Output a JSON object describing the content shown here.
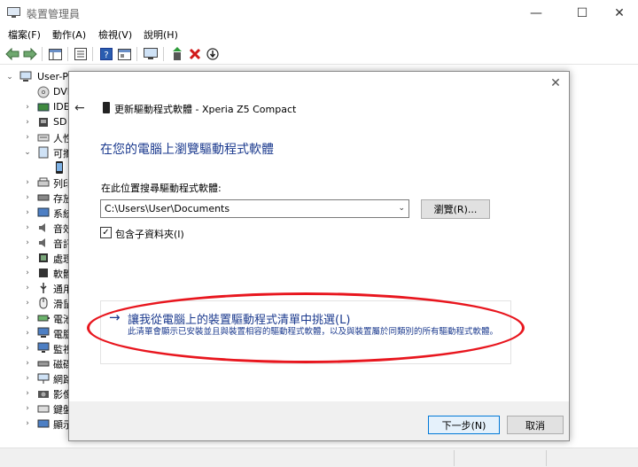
{
  "window": {
    "title": "裝置管理員",
    "min_glyph": "—",
    "max_glyph": "☐",
    "close_glyph": "✕"
  },
  "menu": {
    "items": [
      "檔案(F)",
      "動作(A)",
      "檢視(V)",
      "說明(H)"
    ]
  },
  "tree": {
    "rows": [
      {
        "expander": "⌄",
        "label": "User-P"
      },
      {
        "expander": "",
        "label": "DVI"
      },
      {
        "expander": "›",
        "label": "IDE"
      },
      {
        "expander": "›",
        "label": "SD"
      },
      {
        "expander": "›",
        "label": "人性"
      },
      {
        "expander": "⌄",
        "label": "可攜"
      },
      {
        "expander": "",
        "label": ""
      },
      {
        "expander": "›",
        "label": "列印"
      },
      {
        "expander": "›",
        "label": "存放"
      },
      {
        "expander": "›",
        "label": "系統"
      },
      {
        "expander": "›",
        "label": "音效"
      },
      {
        "expander": "›",
        "label": "音訊"
      },
      {
        "expander": "›",
        "label": "處理"
      },
      {
        "expander": "›",
        "label": "軟體"
      },
      {
        "expander": "›",
        "label": "通用"
      },
      {
        "expander": "›",
        "label": "滑鼠"
      },
      {
        "expander": "›",
        "label": "電池"
      },
      {
        "expander": "›",
        "label": "電腦"
      },
      {
        "expander": "›",
        "label": "監視"
      },
      {
        "expander": "›",
        "label": "磁碟"
      },
      {
        "expander": "›",
        "label": "網路"
      },
      {
        "expander": "›",
        "label": "影像"
      },
      {
        "expander": "›",
        "label": "鍵盤"
      },
      {
        "expander": "›",
        "label": "顯示"
      }
    ]
  },
  "dialog": {
    "close_glyph": "✕",
    "back_glyph": "←",
    "title": "更新驅動程式軟體 - Xperia Z5 Compact",
    "heading": "在您的電腦上瀏覽驅動程式軟體",
    "search_label": "在此位置搜尋驅動程式軟體:",
    "path_value": "C:\\Users\\User\\Documents",
    "combo_arrow": "⌄",
    "browse_label": "瀏覽(R)...",
    "include_checked": "✓",
    "include_label": "包含子資料夾(I)",
    "pick_arrow": "→",
    "pick_link": "讓我從電腦上的裝置驅動程式清單中挑選(L)",
    "pick_desc": "此清單會顯示已安裝並且與裝置相容的驅動程式軟體，以及與裝置屬於同類別的所有驅動程式軟體。",
    "next_label": "下一步(N)",
    "cancel_label": "取消"
  },
  "colors": {
    "link_blue": "#1b3a8e",
    "annotation_red": "#e8161e",
    "primary_button_border": "#0078d7"
  }
}
